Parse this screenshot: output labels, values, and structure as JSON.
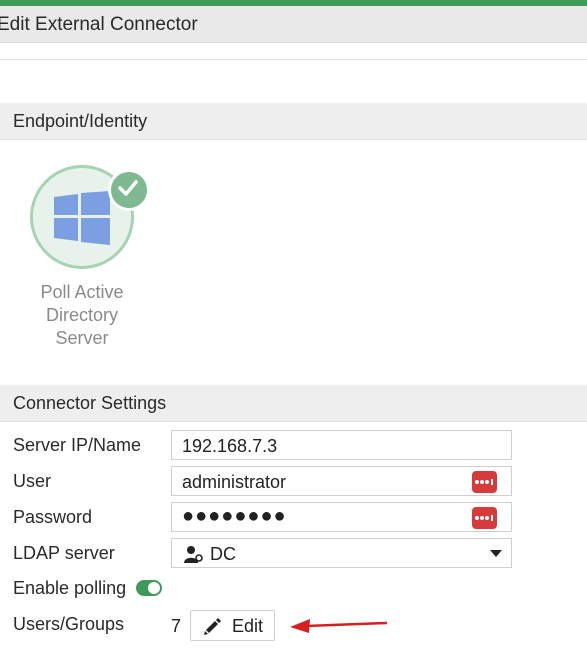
{
  "window": {
    "title": "Edit External Connector"
  },
  "sections": {
    "endpoint": {
      "label": "Endpoint/Identity"
    },
    "connector": {
      "label": "Connector Settings"
    }
  },
  "connector_tile": {
    "label_line1": "Poll Active",
    "label_line2": "Directory",
    "label_line3": "Server",
    "icon": "windows-logo-icon",
    "status_icon": "check-icon",
    "colors": {
      "circle_fill": "#e7f2ea",
      "circle_border": "#a7d3b3",
      "logo": "#7b9fe0",
      "check_badge": "#7fb992"
    }
  },
  "form": {
    "server_ip": {
      "label": "Server IP/Name",
      "value": "192.168.7.3"
    },
    "user": {
      "label": "User",
      "value": "administrator",
      "action_icon": "password-manager-dots-icon"
    },
    "password": {
      "label": "Password",
      "value": "●●●●●●●●",
      "action_icon": "password-manager-dots-icon"
    },
    "ldap_server": {
      "label": "LDAP server",
      "value": "DC",
      "icon": "user-directory-icon"
    },
    "enable_polling": {
      "label": "Enable polling",
      "enabled": true
    },
    "users_groups": {
      "label": "Users/Groups",
      "count": "7",
      "edit_label": "Edit"
    }
  },
  "colors": {
    "accent_green": "#3e9a5c",
    "danger_red": "#d73a3a",
    "annotation_arrow": "#d42020"
  }
}
